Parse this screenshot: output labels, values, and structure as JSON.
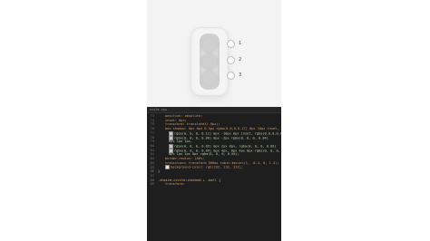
{
  "options": [
    {
      "label": "1"
    },
    {
      "label": "2"
    },
    {
      "label": "3"
    }
  ],
  "editor": {
    "tab_label": "style.css",
    "lines": [
      {
        "num": "73",
        "text": "position: absolute;",
        "kind": "prop"
      },
      {
        "num": "74",
        "text": "inset: 0px;",
        "kind": "prop"
      },
      {
        "num": "75",
        "text": "transform: translateX(-9px);",
        "kind": "prop"
      },
      {
        "num": "76",
        "text": "box-shadow: 0px 0px 0.5px rgba(0,0,0,0.17) 0px 10px inset,",
        "kind": "prop"
      },
      {
        "num": "77",
        "text": "rgba(0, 0, 0, 0.11) 0px -10px 0px inset, rgba(0,0,0,0.04)",
        "kind": "val",
        "swatch": "#c8c8c8"
      },
      {
        "num": "78",
        "text": "rgba(0, 0, 0, 0.06) 0px -2px rgba(0, 0, 0, 0.04)",
        "kind": "val",
        "swatch": "#c8c8c8"
      },
      {
        "num": "79",
        "text": "0px 1px 1px,",
        "kind": "val"
      },
      {
        "num": "80",
        "text": "rgba(0, 0, 0, 0.09) 0px 2px 0px, rgba(0, 0, 0, 0.09)",
        "kind": "val",
        "swatch": "#c8c8c8"
      },
      {
        "num": "81",
        "text": "rgba(0, 0, 0, 0.09) 0px 4px, 0px 4px 0px rgba(0, 0, 0, 0.04)",
        "kind": "val",
        "swatch": "#c8c8c8"
      },
      {
        "num": "82",
        "text": "0px 1px 1px 0px rgba(0, 0, 0, 0.04);",
        "kind": "val"
      },
      {
        "num": "83",
        "text": "border-radius: 100%;",
        "kind": "prop"
      },
      {
        "num": "84",
        "text": "transition: transform 500ms cubic-bezier(1, -0.4, 0, 1.4);",
        "kind": "prop"
      },
      {
        "num": "85",
        "text": "background-color: rgb(232, 232, 232);",
        "kind": "prop",
        "swatch": "#e8e8e8"
      },
      {
        "num": "86",
        "text": "}",
        "kind": "plain"
      },
      {
        "num": "87",
        "text": "",
        "kind": "plain"
      },
      {
        "num": "88",
        "text": ".choice-circle:checked + .ball {",
        "kind": "sel"
      },
      {
        "num": "89",
        "text": "transform:",
        "kind": "prop"
      }
    ]
  }
}
